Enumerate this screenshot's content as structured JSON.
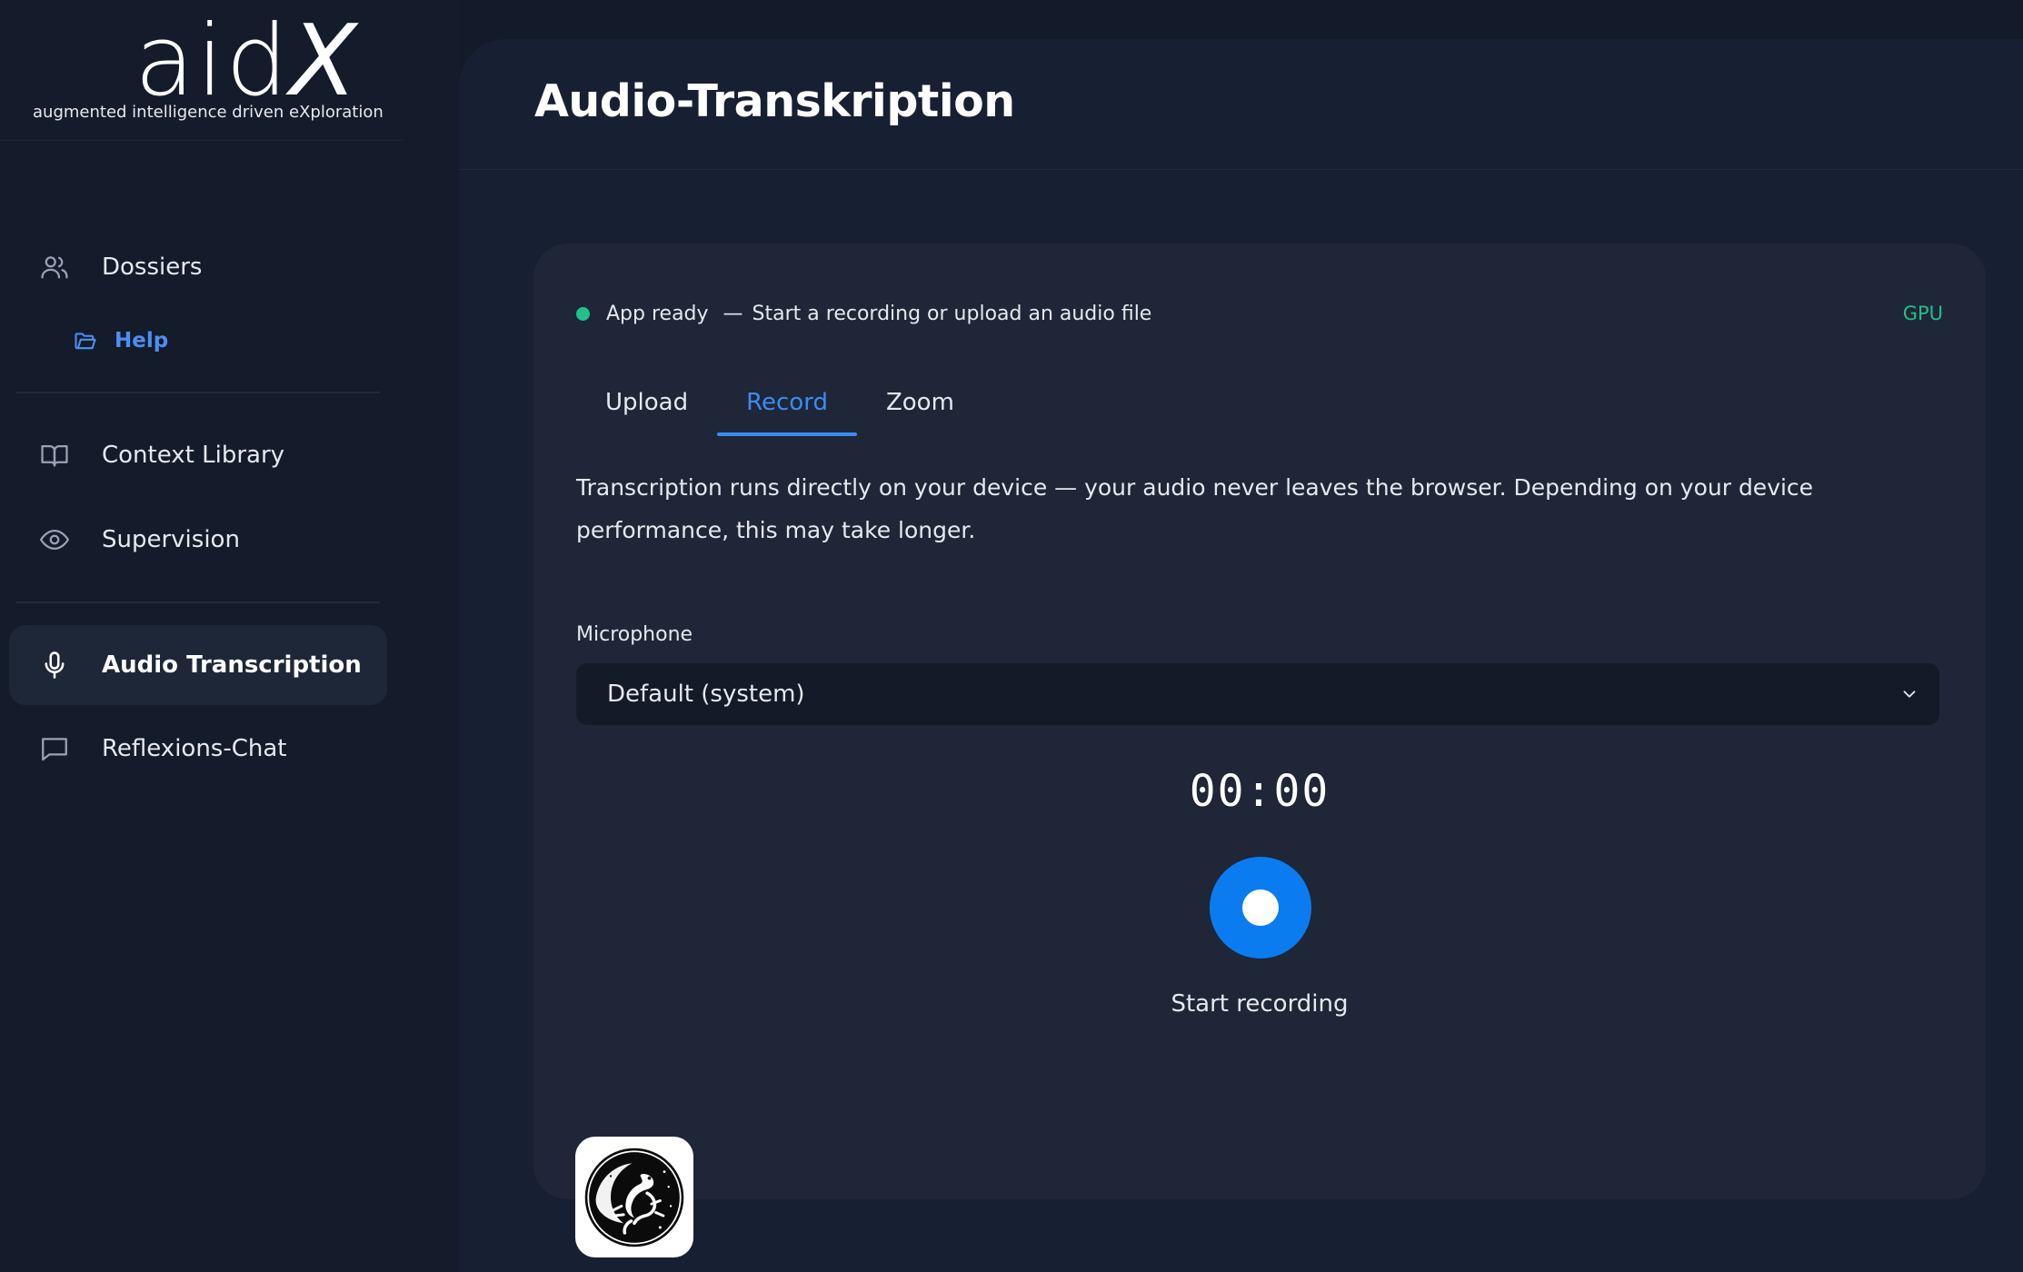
{
  "brand": {
    "wordmark_main": "aid",
    "wordmark_x": "X",
    "tagline": "augmented intelligence driven eXploration"
  },
  "sidebar": {
    "items": [
      {
        "label": "Dossiers",
        "icon": "users-icon"
      },
      {
        "label": "Help",
        "icon": "folder-open-icon"
      },
      {
        "label": "Context Library",
        "icon": "book-open-icon"
      },
      {
        "label": "Supervision",
        "icon": "eye-icon"
      },
      {
        "label": "Audio Transcription",
        "icon": "microphone-icon",
        "active": true
      },
      {
        "label": "Reflexions-Chat",
        "icon": "chat-bubble-icon"
      }
    ]
  },
  "page": {
    "title": "Audio-Transkription"
  },
  "status": {
    "state": "App ready",
    "separator": "—",
    "message": "Start a recording or upload an audio file",
    "badge": "GPU"
  },
  "tabs": [
    {
      "label": "Upload"
    },
    {
      "label": "Record",
      "active": true
    },
    {
      "label": "Zoom"
    }
  ],
  "record": {
    "description": "Transcription runs directly on your device — your audio never leaves the browser. Depending on your device performance, this may take longer.",
    "microphone_label": "Microphone",
    "microphone_value": "Default (system)",
    "timer": "00:00",
    "button_label": "Start recording"
  },
  "colors": {
    "accent": "#3b8bf5",
    "record_button": "#0a7cf0",
    "status_ok": "#22c08a",
    "background": "#131a2a",
    "card": "#1e2637"
  }
}
